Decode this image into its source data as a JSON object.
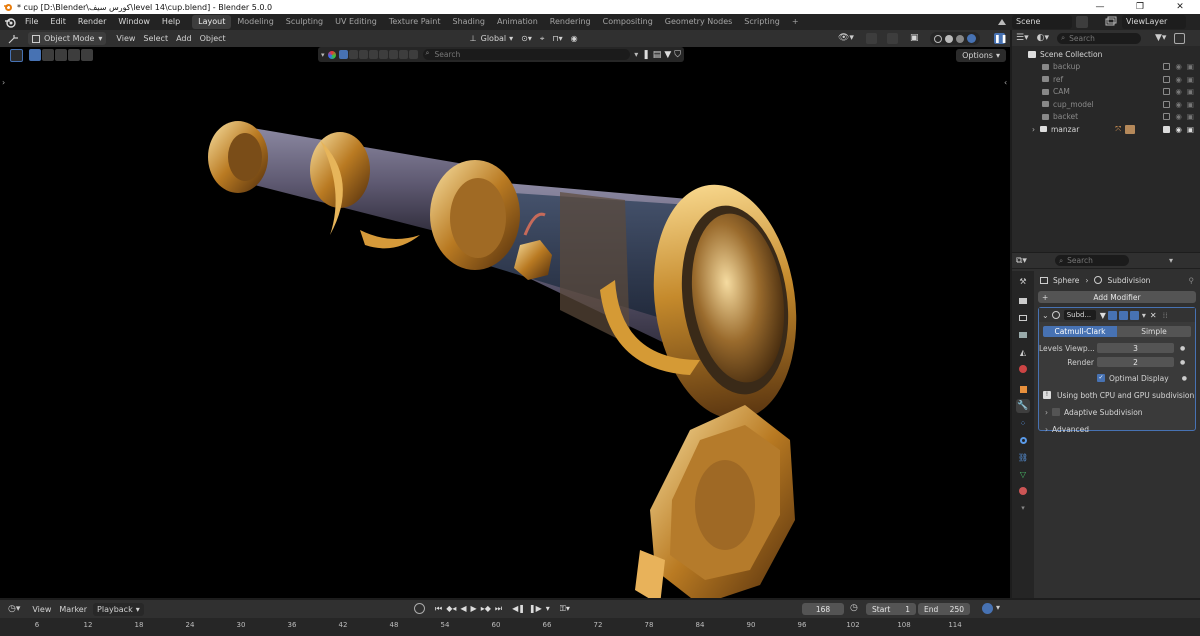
{
  "window": {
    "title": "* cup [D:\\Blender\\كورس سيف\\level 14\\cup.blend] - Blender 5.0.0",
    "controls": [
      "—",
      "❐",
      "✕"
    ]
  },
  "menus": [
    "File",
    "Edit",
    "Render",
    "Window",
    "Help"
  ],
  "workspaces": [
    {
      "label": "Layout",
      "active": true
    },
    {
      "label": "Modeling"
    },
    {
      "label": "Sculpting"
    },
    {
      "label": "UV Editing"
    },
    {
      "label": "Texture Paint"
    },
    {
      "label": "Shading"
    },
    {
      "label": "Animation"
    },
    {
      "label": "Rendering"
    },
    {
      "label": "Compositing"
    },
    {
      "label": "Geometry Nodes"
    },
    {
      "label": "Scripting"
    }
  ],
  "add_workspace": "+",
  "scene": {
    "label": "Scene",
    "view_layer": "ViewLayer"
  },
  "viewport": {
    "mode": "Object Mode",
    "menus": [
      "View",
      "Select",
      "Add",
      "Object"
    ],
    "orientation": "Global",
    "search_placeholder": "Search",
    "options_label": "Options"
  },
  "outliner": {
    "search_placeholder": "Search",
    "root": "Scene Collection",
    "items": [
      {
        "name": "backup",
        "enabled": false
      },
      {
        "name": "ref",
        "enabled": false
      },
      {
        "name": "CAM",
        "enabled": false
      },
      {
        "name": "cup_model",
        "enabled": false
      },
      {
        "name": "backet",
        "enabled": false
      },
      {
        "name": "manzar",
        "enabled": true
      }
    ]
  },
  "properties": {
    "search_placeholder": "Search",
    "breadcrumb_object": "Sphere",
    "breadcrumb_modifier": "Subdivision",
    "add_modifier": "Add Modifier",
    "modifier": {
      "name": "Subd...",
      "type_active": "Catmull-Clark",
      "type_other": "Simple",
      "levels_label": "Levels Viewp...",
      "levels_value": "3",
      "render_label": "Render",
      "render_value": "2",
      "optimal_display": "Optimal Display",
      "info": "Using both CPU and GPU subdivision",
      "adaptive": "Adaptive Subdivision",
      "advanced": "Advanced"
    }
  },
  "timeline": {
    "menus": [
      "View",
      "Marker"
    ],
    "playback": "Playback",
    "current_frame": "168",
    "start_label": "Start",
    "start": "1",
    "end_label": "End",
    "end": "250",
    "ticks": [
      "6",
      "12",
      "18",
      "24",
      "30",
      "36",
      "42",
      "48",
      "54",
      "60",
      "66",
      "72",
      "78",
      "84",
      "90",
      "96",
      "102",
      "108",
      "114"
    ]
  },
  "colors": {
    "accent": "#4772b3",
    "gold": "#c9952e",
    "sleeve": "#3d4a63"
  }
}
